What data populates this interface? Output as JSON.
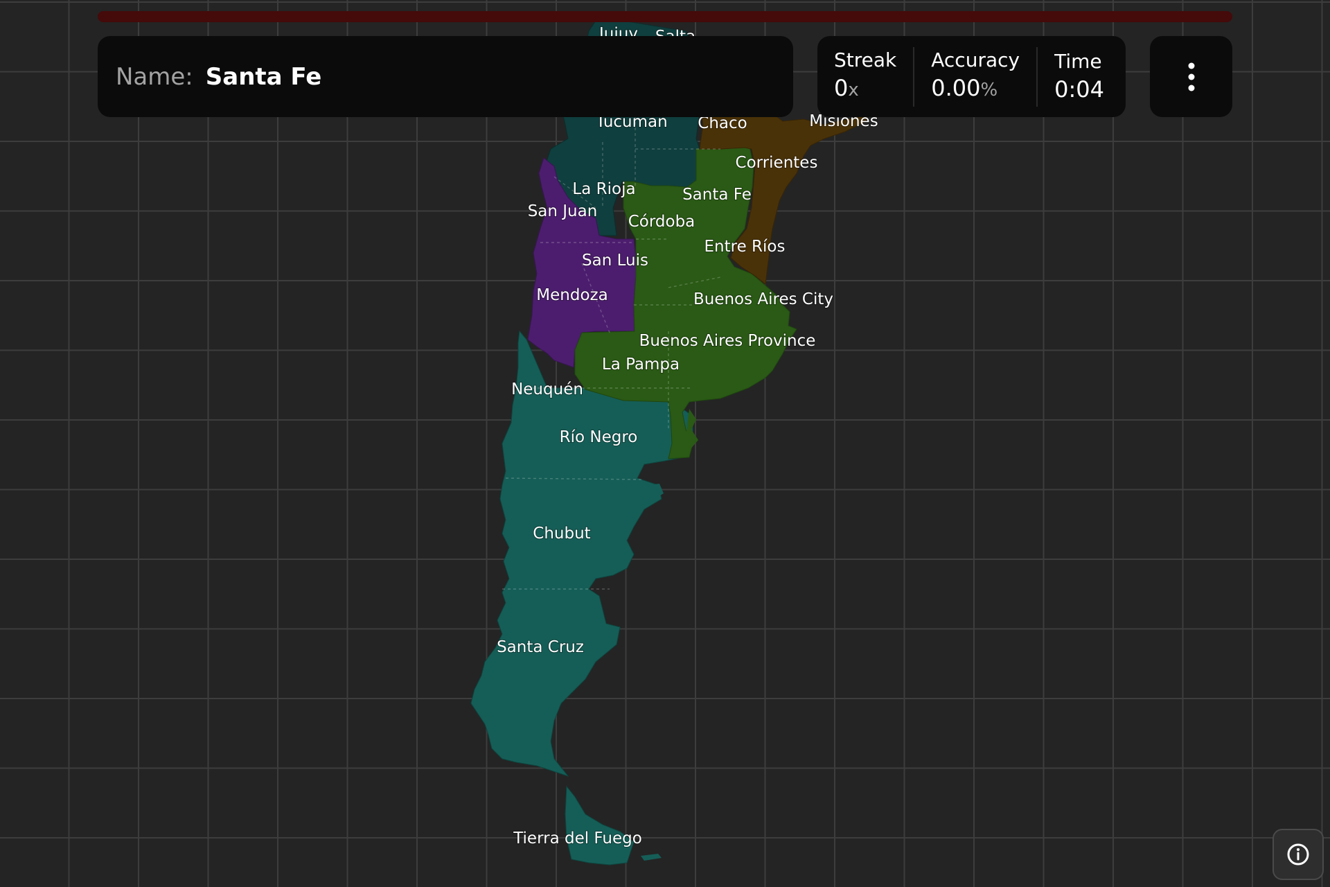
{
  "header": {
    "name_label": "Name:",
    "name_value": "Santa Fe"
  },
  "stats": {
    "streak_label": "Streak",
    "streak_value": "0",
    "streak_unit": "x",
    "accuracy_label": "Accuracy",
    "accuracy_value": "0.00",
    "accuracy_unit": "%",
    "time_label": "Time",
    "time_value": "0:04"
  },
  "progress": {
    "fraction": 0.0,
    "color": "#450a0a"
  },
  "map": {
    "region_colors": {
      "north_teal": "#0f3f3e",
      "patagonia_teal": "#155e57",
      "purple": "#4c1d6e",
      "green": "#2a5a15",
      "brown": "#4a3208"
    },
    "labels": {
      "jujuy": "Jujuy",
      "salta": "Salta",
      "tucuman": "Tucumán",
      "chaco": "Chaco",
      "misiones": "Misiones",
      "corrientes": "Corrientes",
      "la_rioja": "La Rioja",
      "santa_fe": "Santa Fe",
      "san_juan": "San Juan",
      "cordoba": "Córdoba",
      "entre_rios": "Entre Ríos",
      "san_luis": "San Luis",
      "mendoza": "Mendoza",
      "buenos_aires_city": "Buenos Aires City",
      "buenos_aires_province": "Buenos Aires Province",
      "la_pampa": "La Pampa",
      "neuquen": "Neuquén",
      "rio_negro": "Río Negro",
      "chubut": "Chubut",
      "santa_cruz": "Santa Cruz",
      "tierra_del_fuego": "Tierra del Fuego"
    }
  },
  "icons": {
    "menu": "more-vertical-icon",
    "info": "info-icon"
  }
}
